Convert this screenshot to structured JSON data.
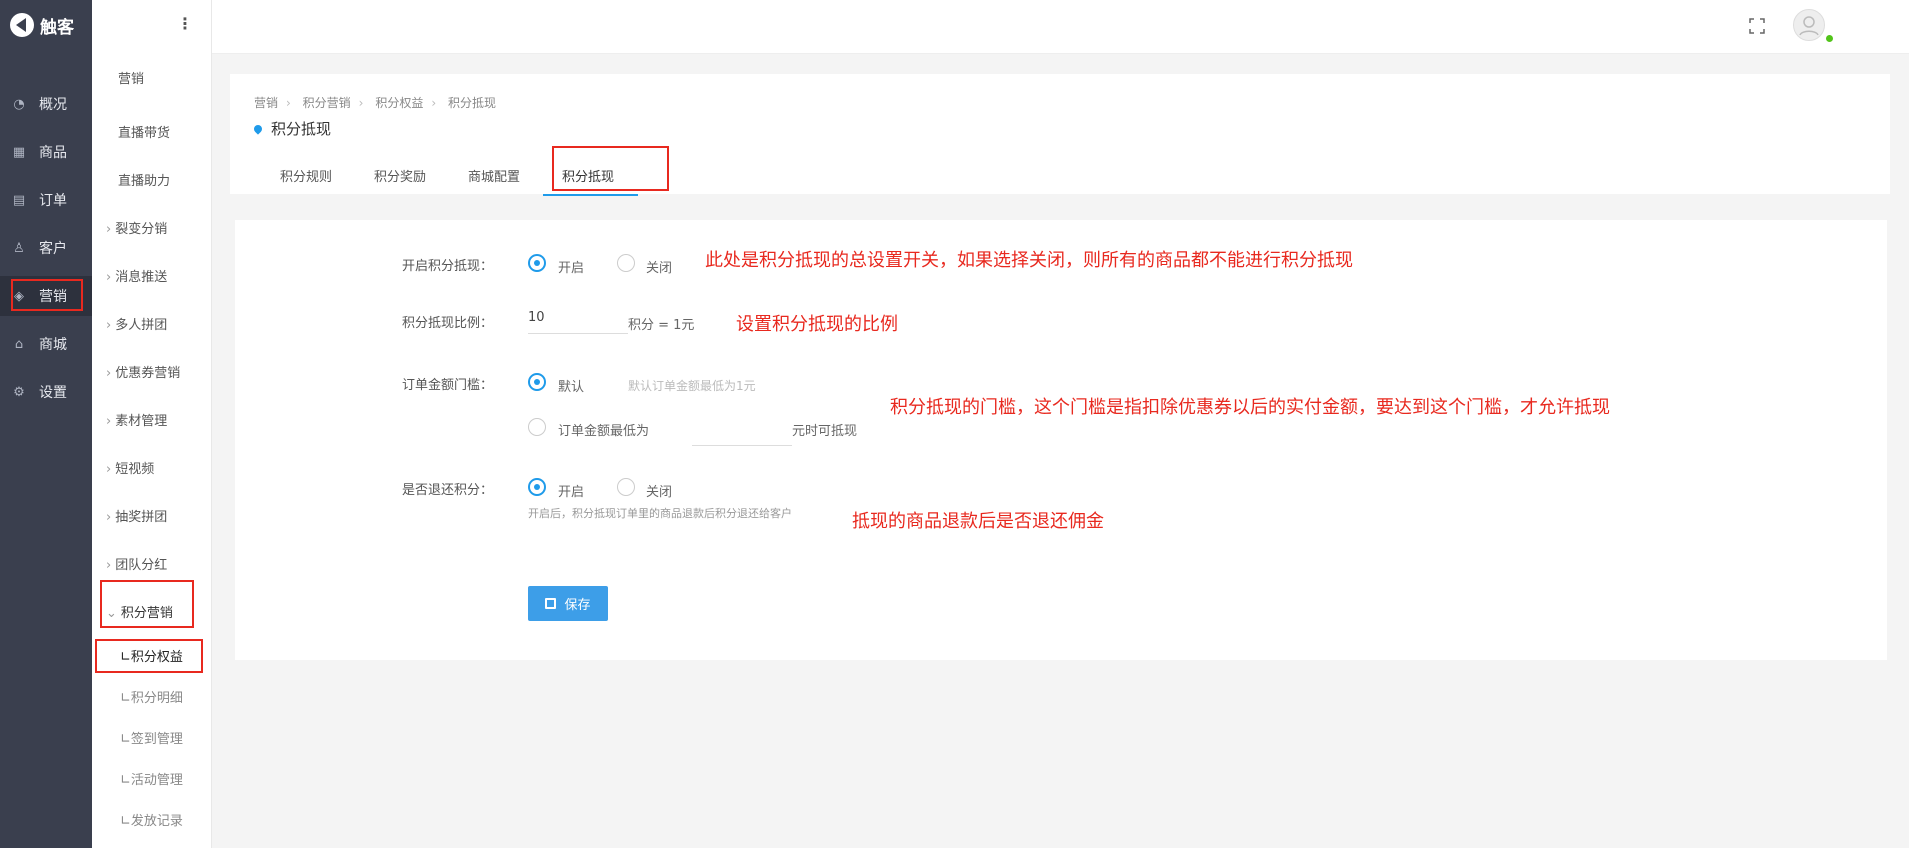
{
  "brand": {
    "name": "触客"
  },
  "main_nav": {
    "items": [
      {
        "label": "概况",
        "icon": "gauge-icon"
      },
      {
        "label": "商品",
        "icon": "grid-icon"
      },
      {
        "label": "订单",
        "icon": "calendar-icon"
      },
      {
        "label": "客户",
        "icon": "user-icon"
      },
      {
        "label": "营销",
        "icon": "tag-icon"
      },
      {
        "label": "商城",
        "icon": "shop-icon"
      },
      {
        "label": "设置",
        "icon": "gear-icon"
      }
    ],
    "active": "营销"
  },
  "sub_nav": {
    "items": [
      {
        "label": "营销"
      },
      {
        "label": "直播带货"
      },
      {
        "label": "直播助力"
      },
      {
        "label": "裂变分销"
      },
      {
        "label": "消息推送"
      },
      {
        "label": "多人拼团"
      },
      {
        "label": "优惠券营销"
      },
      {
        "label": "素材管理"
      },
      {
        "label": "短视频"
      },
      {
        "label": "抽奖拼团"
      },
      {
        "label": "团队分红"
      },
      {
        "label": "积分营销"
      },
      {
        "label": "∟积分权益"
      },
      {
        "label": "∟积分明细"
      },
      {
        "label": "∟签到管理"
      },
      {
        "label": "∟活动管理"
      },
      {
        "label": "∟发放记录"
      }
    ]
  },
  "header": {
    "breadcrumb": [
      "营销",
      "积分营销",
      "积分权益",
      "积分抵现"
    ],
    "title": "积分抵现",
    "tabs": [
      {
        "label": "积分规则"
      },
      {
        "label": "积分奖励"
      },
      {
        "label": "商城配置"
      },
      {
        "label": "积分抵现"
      }
    ],
    "active_tab": "积分抵现"
  },
  "form": {
    "enable": {
      "label": "开启积分抵现：",
      "on_label": "开启",
      "off_label": "关闭",
      "selected": "开启"
    },
    "ratio": {
      "label": "积分抵现比例：",
      "value": "10",
      "suffix": "积分 = 1元"
    },
    "threshold": {
      "label": "订单金额门槛：",
      "default_label": "默认",
      "default_hint": "默认订单金额最低为1元",
      "custom_prefix": "订单金额最低为",
      "custom_suffix": "元时可抵现",
      "selected": "默认"
    },
    "refund": {
      "label": "是否退还积分：",
      "on_label": "开启",
      "off_label": "关闭",
      "selected": "开启",
      "hint": "开启后，积分抵现订单里的商品退款后积分退还给客户"
    },
    "save_label": "保存"
  },
  "annotations": {
    "a1": "此处是积分抵现的总设置开关，如果选择关闭，则所有的商品都不能进行积分抵现",
    "a2": "设置积分抵现的比例",
    "a3": "积分抵现的门槛，这个门槛是指扣除优惠券以后的实付金额，要达到这个门槛，才允许抵现",
    "a4": "抵现的商品退款后是否退还佣金"
  },
  "colors": {
    "accent": "#1f9bea",
    "annotation": "#e8291f",
    "sidebar": "#3a3f4e"
  }
}
